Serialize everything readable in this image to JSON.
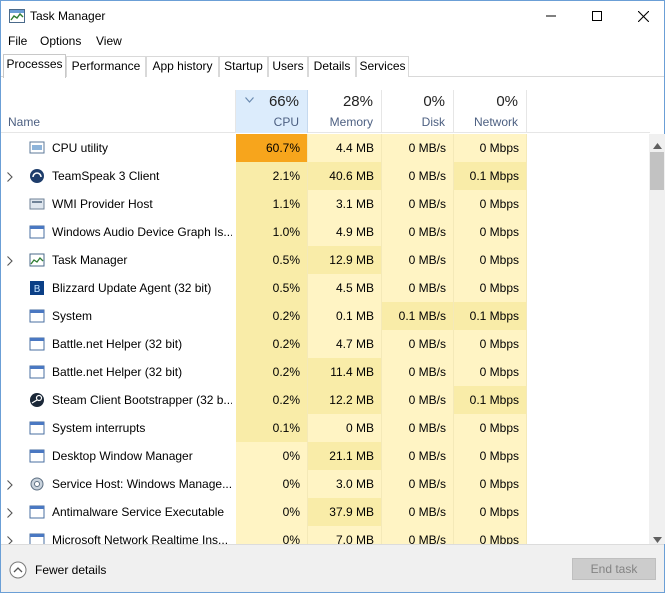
{
  "window": {
    "title": "Task Manager"
  },
  "menu": [
    "File",
    "Options",
    "View"
  ],
  "tabs": [
    "Processes",
    "Performance",
    "App history",
    "Startup",
    "Users",
    "Details",
    "Services"
  ],
  "header": {
    "name_label": "Name",
    "cpu": {
      "pct": "66%",
      "label": "CPU"
    },
    "memory": {
      "pct": "28%",
      "label": "Memory"
    },
    "disk": {
      "pct": "0%",
      "label": "Disk"
    },
    "network": {
      "pct": "0%",
      "label": "Network"
    }
  },
  "colors": {
    "heat_light": "#fff4c4",
    "heat_medium": "#f9eca8",
    "heat_strong": "#ffd36e",
    "heat_hot": "#f7a51c",
    "sorted_header": "#dcecfc"
  },
  "rows": [
    {
      "name": "CPU utility",
      "icon": "cpu-utility-icon",
      "expandable": false,
      "cpu": "60.7%",
      "memory": "4.4 MB",
      "disk": "0 MB/s",
      "network": "0 Mbps",
      "heat": [
        "hot",
        "light",
        "light",
        "light"
      ]
    },
    {
      "name": "TeamSpeak 3 Client",
      "icon": "teamspeak-icon",
      "expandable": true,
      "cpu": "2.1%",
      "memory": "40.6 MB",
      "disk": "0 MB/s",
      "network": "0.1 Mbps",
      "heat": [
        "medium",
        "medium",
        "light",
        "medium"
      ]
    },
    {
      "name": "WMI Provider Host",
      "icon": "wmi-host-icon",
      "expandable": false,
      "cpu": "1.1%",
      "memory": "3.1 MB",
      "disk": "0 MB/s",
      "network": "0 Mbps",
      "heat": [
        "medium",
        "light",
        "light",
        "light"
      ]
    },
    {
      "name": "Windows Audio Device Graph Is...",
      "icon": "audio-device-icon",
      "expandable": false,
      "cpu": "1.0%",
      "memory": "4.9 MB",
      "disk": "0 MB/s",
      "network": "0 Mbps",
      "heat": [
        "medium",
        "light",
        "light",
        "light"
      ]
    },
    {
      "name": "Task Manager",
      "icon": "task-manager-icon",
      "expandable": true,
      "cpu": "0.5%",
      "memory": "12.9 MB",
      "disk": "0 MB/s",
      "network": "0 Mbps",
      "heat": [
        "medium",
        "medium",
        "light",
        "light"
      ]
    },
    {
      "name": "Blizzard Update Agent (32 bit)",
      "icon": "blizzard-icon",
      "expandable": false,
      "cpu": "0.5%",
      "memory": "4.5 MB",
      "disk": "0 MB/s",
      "network": "0 Mbps",
      "heat": [
        "medium",
        "light",
        "light",
        "light"
      ]
    },
    {
      "name": "System",
      "icon": "system-icon",
      "expandable": false,
      "cpu": "0.2%",
      "memory": "0.1 MB",
      "disk": "0.1 MB/s",
      "network": "0.1 Mbps",
      "heat": [
        "medium",
        "light",
        "medium",
        "medium"
      ]
    },
    {
      "name": "Battle.net Helper (32 bit)",
      "icon": "battlenet-icon",
      "expandable": false,
      "cpu": "0.2%",
      "memory": "4.7 MB",
      "disk": "0 MB/s",
      "network": "0 Mbps",
      "heat": [
        "medium",
        "light",
        "light",
        "light"
      ]
    },
    {
      "name": "Battle.net Helper (32 bit)",
      "icon": "battlenet-icon",
      "expandable": false,
      "cpu": "0.2%",
      "memory": "11.4 MB",
      "disk": "0 MB/s",
      "network": "0 Mbps",
      "heat": [
        "medium",
        "medium",
        "light",
        "light"
      ]
    },
    {
      "name": "Steam Client Bootstrapper (32 b...",
      "icon": "steam-icon",
      "expandable": false,
      "cpu": "0.2%",
      "memory": "12.2 MB",
      "disk": "0 MB/s",
      "network": "0.1 Mbps",
      "heat": [
        "medium",
        "medium",
        "light",
        "medium"
      ]
    },
    {
      "name": "System interrupts",
      "icon": "system-interrupts-icon",
      "expandable": false,
      "cpu": "0.1%",
      "memory": "0 MB",
      "disk": "0 MB/s",
      "network": "0 Mbps",
      "heat": [
        "medium",
        "light",
        "light",
        "light"
      ]
    },
    {
      "name": "Desktop Window Manager",
      "icon": "desktop-window-manager-icon",
      "expandable": false,
      "cpu": "0%",
      "memory": "21.1 MB",
      "disk": "0 MB/s",
      "network": "0 Mbps",
      "heat": [
        "light",
        "medium",
        "light",
        "light"
      ]
    },
    {
      "name": "Service Host: Windows Manage...",
      "icon": "service-host-icon",
      "expandable": true,
      "cpu": "0%",
      "memory": "3.0 MB",
      "disk": "0 MB/s",
      "network": "0 Mbps",
      "heat": [
        "light",
        "light",
        "light",
        "light"
      ]
    },
    {
      "name": "Antimalware Service Executable",
      "icon": "antimalware-icon",
      "expandable": true,
      "cpu": "0%",
      "memory": "37.9 MB",
      "disk": "0 MB/s",
      "network": "0 Mbps",
      "heat": [
        "light",
        "medium",
        "light",
        "light"
      ]
    },
    {
      "name": "Microsoft Network Realtime Ins...",
      "icon": "network-realtime-icon",
      "expandable": true,
      "cpu": "0%",
      "memory": "7.0 MB",
      "disk": "0 MB/s",
      "network": "0 Mbps",
      "heat": [
        "light",
        "light",
        "light",
        "light"
      ]
    }
  ],
  "footer": {
    "fewer_details": "Fewer details",
    "end_task": "End task"
  }
}
